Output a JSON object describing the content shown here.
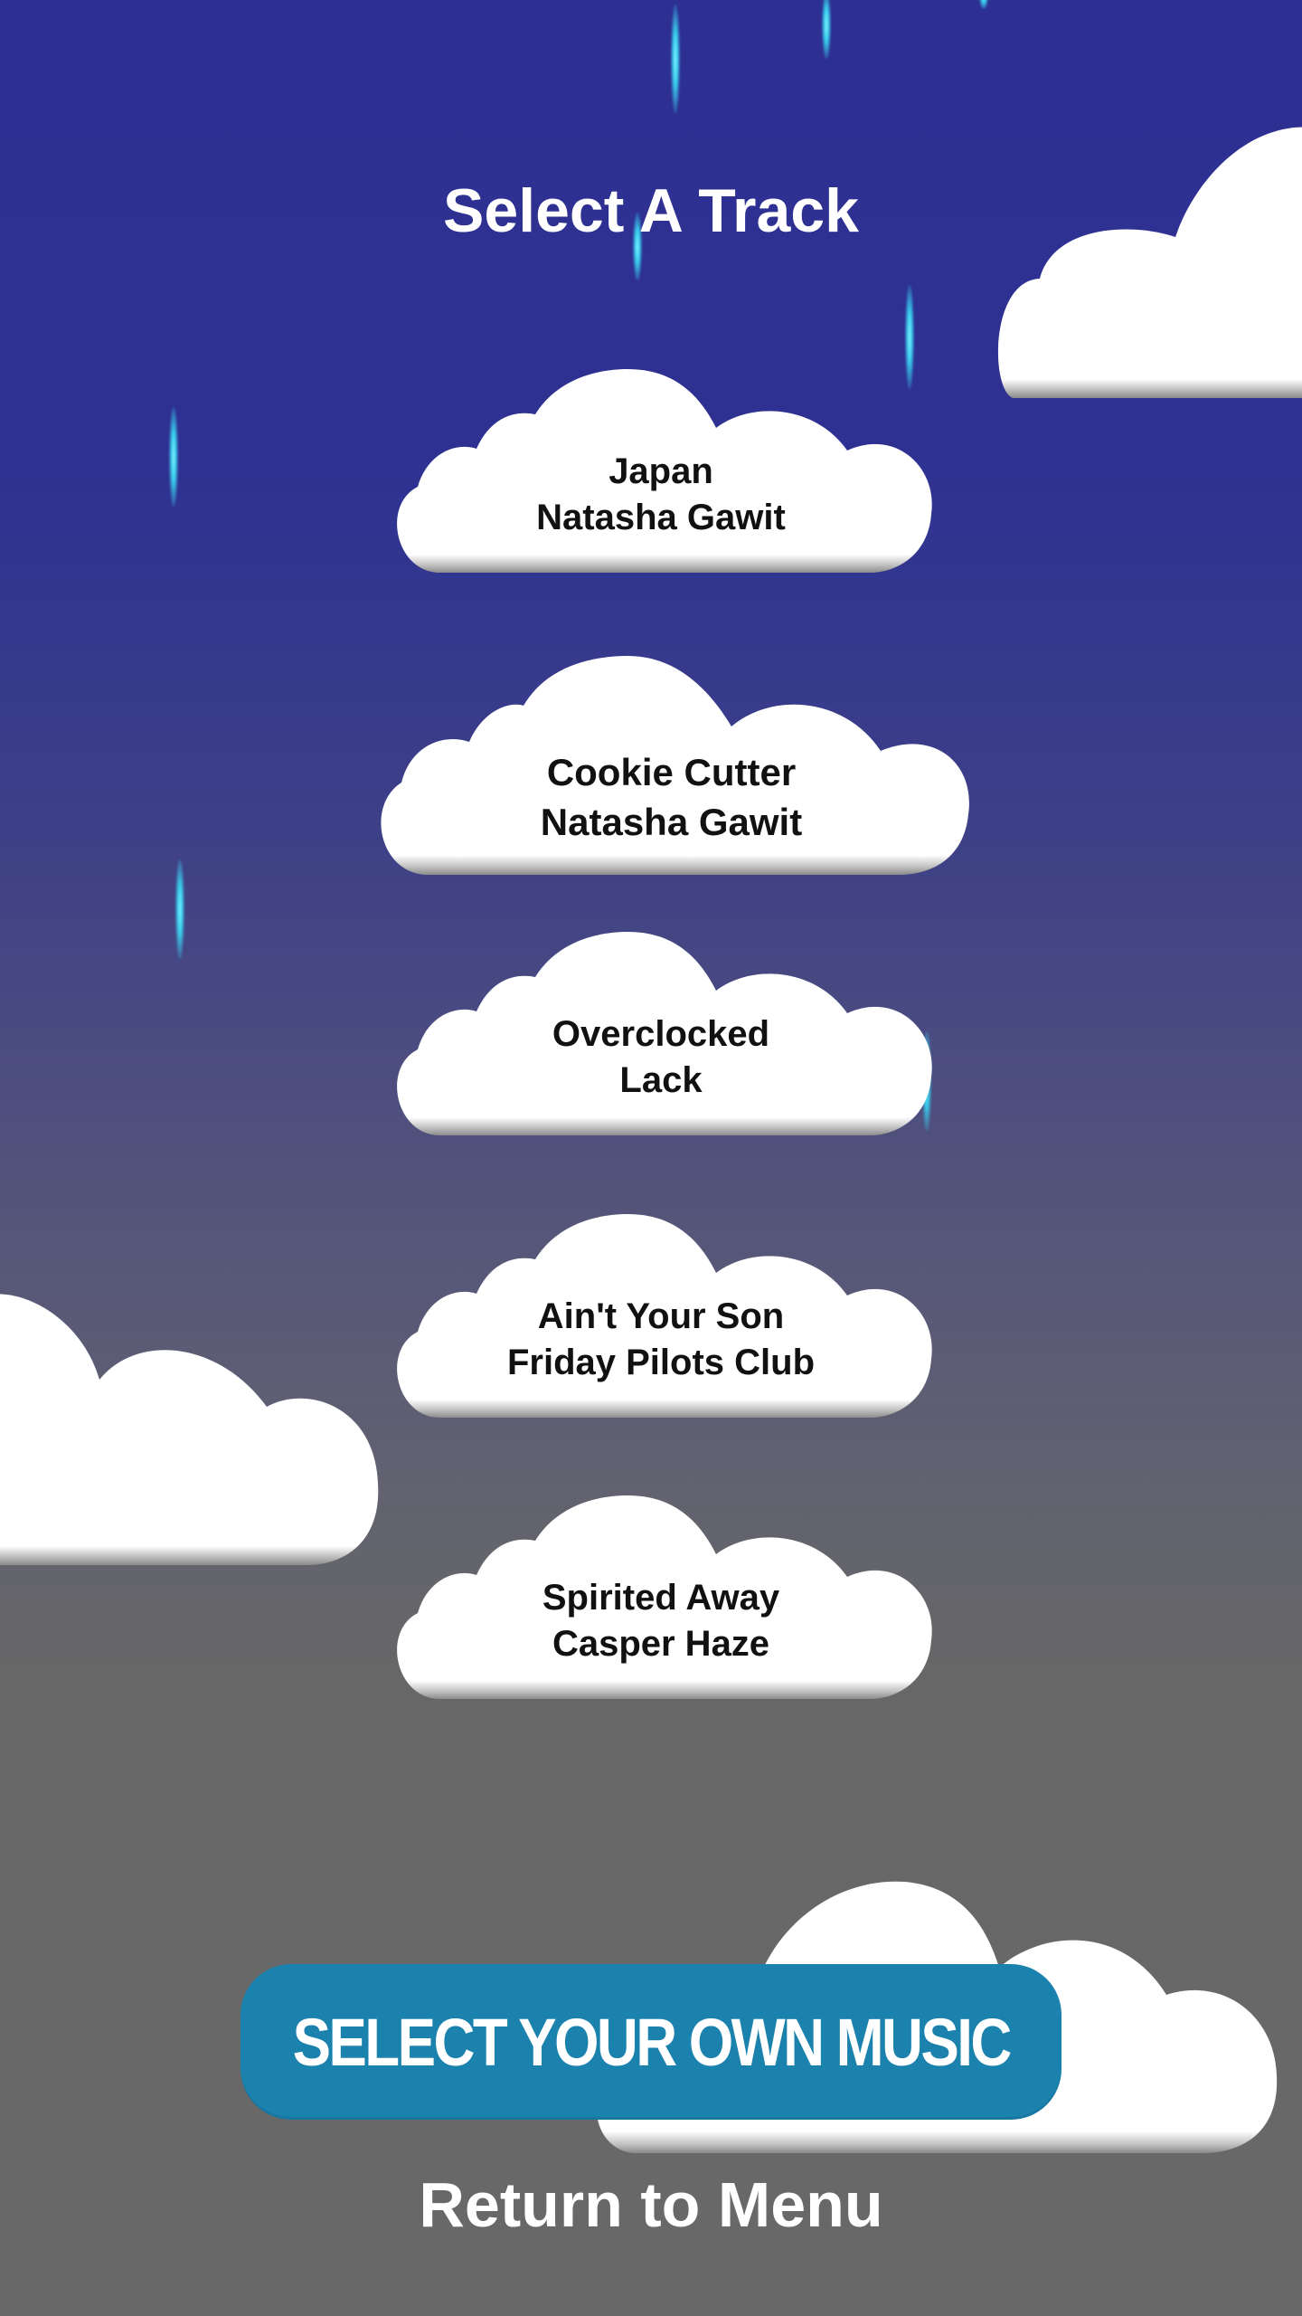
{
  "screen": {
    "title": "Select A Track",
    "colors": {
      "sky_top": "#2e3192",
      "sky_bottom": "#686868",
      "cloud": "#ffffff",
      "cloud_shadow": "#8c8c8c",
      "rain": "#3ad0ee",
      "button": "#1b82ae",
      "track_text": "#111111"
    }
  },
  "tracks": [
    {
      "title": "Japan",
      "artist": "Natasha Gawit"
    },
    {
      "title": "Cookie Cutter",
      "artist": "Natasha Gawit"
    },
    {
      "title": "Overclocked",
      "artist": "Lack"
    },
    {
      "title": "Ain't Your Son",
      "artist": "Friday Pilots Club"
    },
    {
      "title": "Spirited Away",
      "artist": "Casper Haze"
    }
  ],
  "actions": {
    "select_own_music": "SELECT YOUR OWN MUSIC",
    "return_to_menu": "Return to Menu"
  },
  "icons": {
    "cloud": "cloud-icon",
    "rain": "raindrop-icon"
  }
}
